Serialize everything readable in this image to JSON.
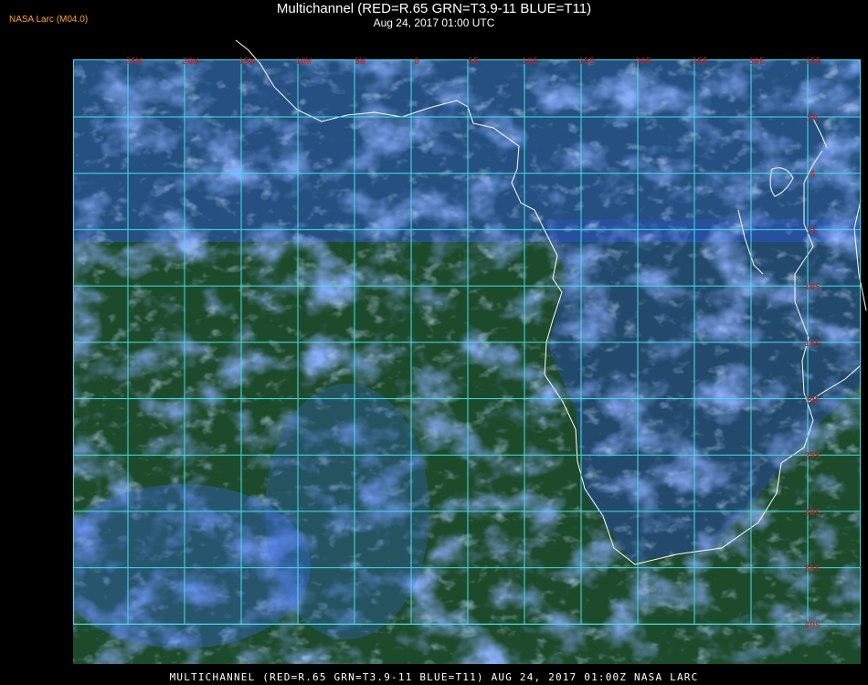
{
  "header": {
    "credit": "NASA Larc (M04.0)",
    "title": "Multichannel (RED=R.65 GRN=T3.9-11 BLUE=T11)",
    "subtitle": "Aug 24, 2017 01:00 UTC"
  },
  "footer": {
    "text": "MULTICHANNEL (RED=R.65 GRN=T3.9-11 BLUE=T11) AUG 24, 2017 01:00Z  NASA LARC"
  },
  "map": {
    "lon_labels": [
      "25W",
      "20W",
      "15W",
      "10W",
      "5W",
      "0",
      "5E",
      "10E",
      "15E",
      "20E",
      "25E",
      "30E",
      "35E"
    ],
    "lat_labels": [
      "5N",
      "0",
      "5S",
      "10S",
      "15S",
      "20S",
      "25S",
      "30S",
      "35S",
      "40S"
    ],
    "colors": {
      "grid": "#3fe0e8",
      "labels": "#c41e1e",
      "coastline": "#ffffff",
      "background": "#000000",
      "ocean_tint": "#1f4a2a",
      "cloud_tint": "#3a6cf0"
    }
  }
}
